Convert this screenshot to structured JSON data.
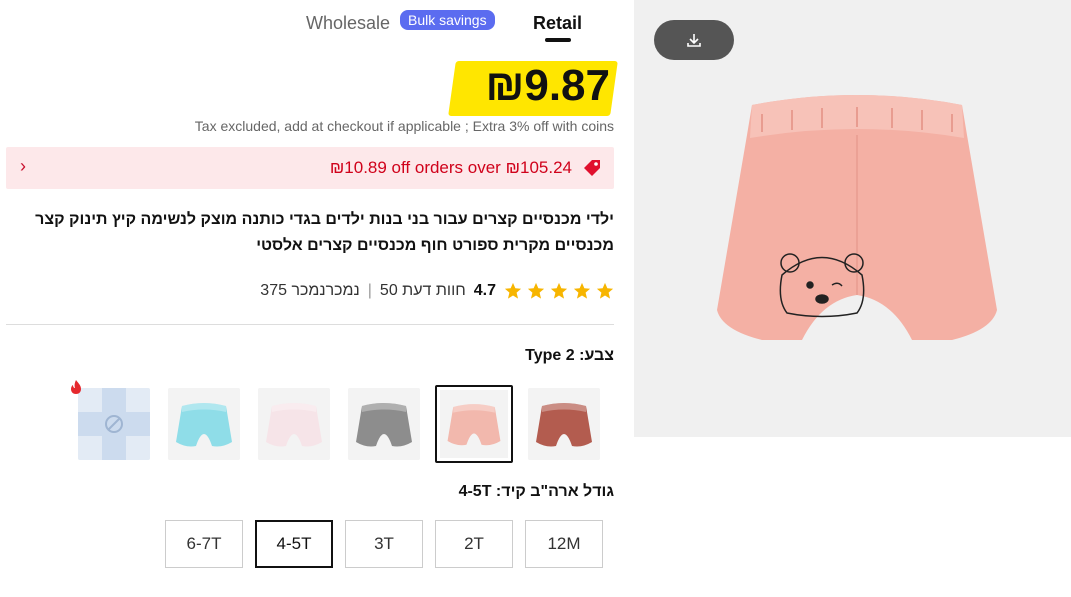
{
  "tabs": {
    "wholesale": "Wholesale",
    "badge": "Bulk savings",
    "retail": "Retail"
  },
  "price": "₪9.87",
  "tax_note": "Tax excluded, add at checkout if applicable ; Extra 3% off with coins",
  "promo": {
    "text": "₪10.89 off orders over ₪105.24"
  },
  "title": "ילדי מכנסיים קצרים עבור בני בנות ילדים בגדי כותנה מוצק לנשימה קיץ תינוק קצר מכנסיים מקרית ספורט חוף מכנסיים קצרים אלסטי",
  "rating": {
    "score": "4.7",
    "reviews": "50 חוות דעת",
    "sold": "375 נמכרנמכר",
    "stars": 5
  },
  "color": {
    "label": "צבע: Type 2"
  },
  "swatches": [
    {
      "name": "brown",
      "color": "#b35c4f",
      "selected": false
    },
    {
      "name": "pink",
      "color": "#f2b8ad",
      "selected": true
    },
    {
      "name": "gray",
      "color": "#8d8d8d",
      "selected": false
    },
    {
      "name": "donut-print",
      "color": "#f6e4e8",
      "selected": false
    },
    {
      "name": "light-blue",
      "color": "#8fdde8",
      "selected": false
    },
    {
      "name": "unavailable",
      "color": "#d9e4f1",
      "selected": false
    }
  ],
  "size": {
    "label": "גודל ארה\"ב קיד: 4-5T"
  },
  "sizes": [
    "12M",
    "2T",
    "3T",
    "4-5T",
    "6-7T"
  ],
  "selected_size": "4-5T",
  "colors": {
    "accent_red": "#d0021b",
    "highlight": "#ffe600",
    "badge": "#5b6cf0",
    "star": "#f7b500"
  },
  "icons": [
    "chevron-right-icon",
    "tag-icon",
    "star-icon",
    "fire-icon",
    "download-icon",
    "unavailable-icon"
  ]
}
